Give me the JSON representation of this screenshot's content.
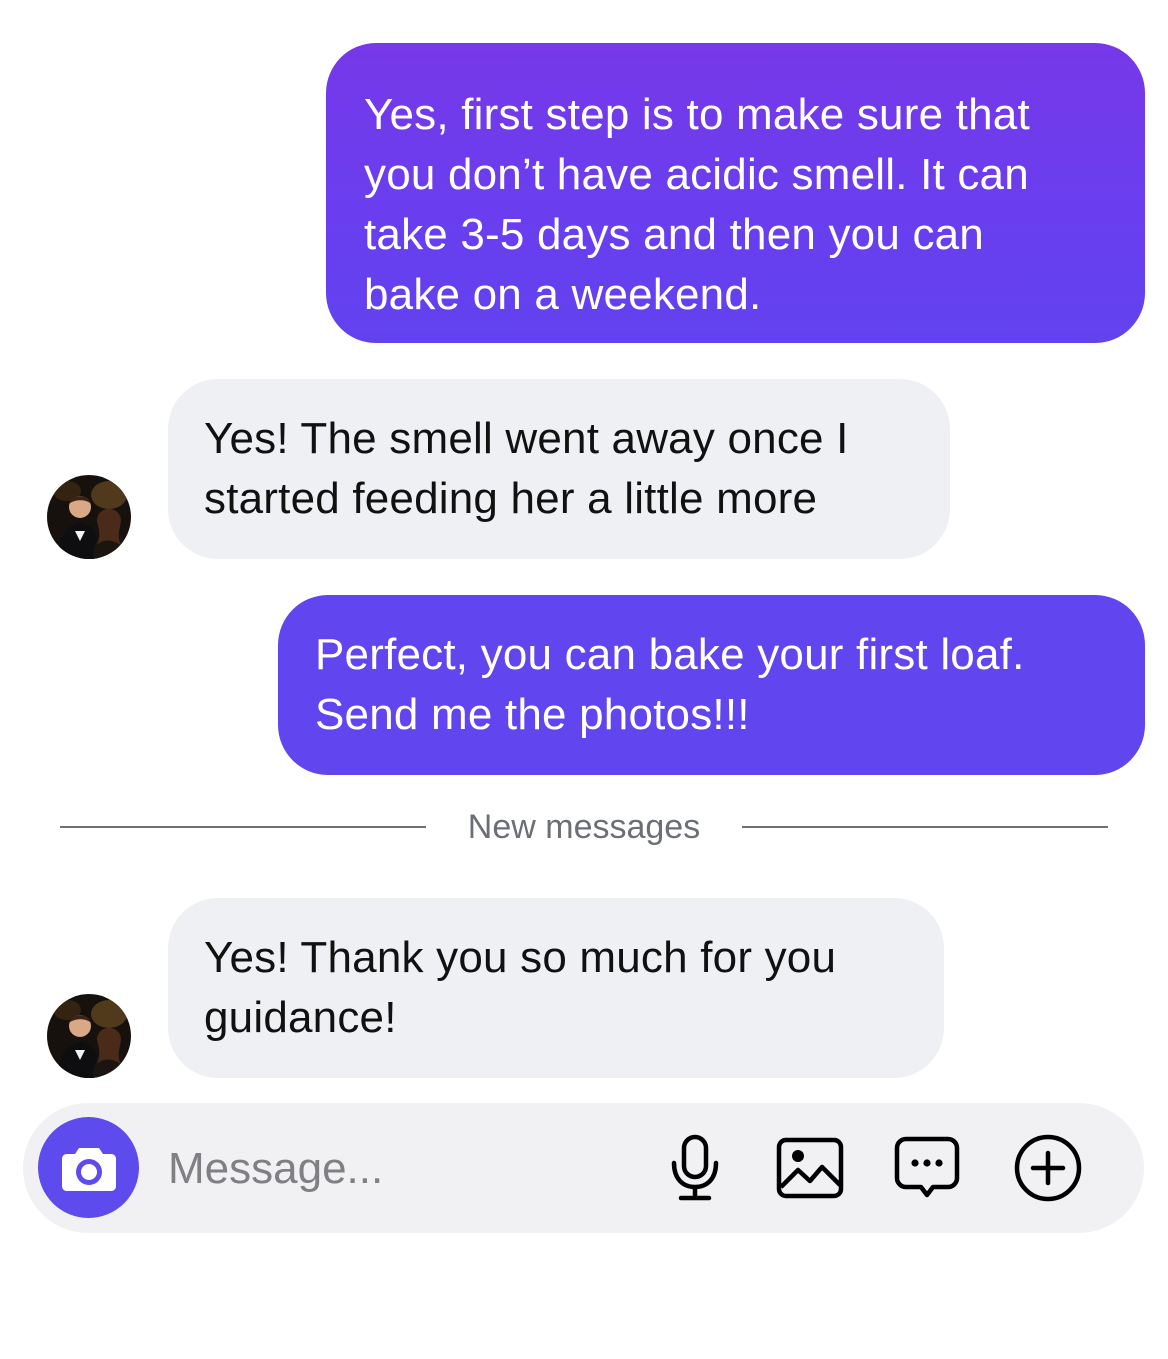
{
  "messages": [
    {
      "direction": "sent",
      "text": "Yes, first step is to make sure that\nyou don’t have acidic smell. It can\ntake 3-5 days and then you can\nbake on a weekend."
    },
    {
      "direction": "received",
      "text": "Yes! The smell went away once I\nstarted feeding her a little more"
    },
    {
      "direction": "sent",
      "text": "Perfect, you can bake your first loaf.\nSend me the photos!!!"
    },
    {
      "direction": "received",
      "text": "Yes! Thank you so much for you\nguidance!"
    }
  ],
  "divider": {
    "label": "New messages"
  },
  "composer": {
    "placeholder": "Message...",
    "icons": [
      "camera-icon",
      "microphone-icon",
      "gallery-icon",
      "sticker-icon",
      "plus-icon"
    ]
  },
  "colors": {
    "sent_bubble": "#6145ef",
    "sent_bubble_top": "#7638e8",
    "received_bubble": "#eff0f4",
    "camera_button": "#5e4bed"
  }
}
